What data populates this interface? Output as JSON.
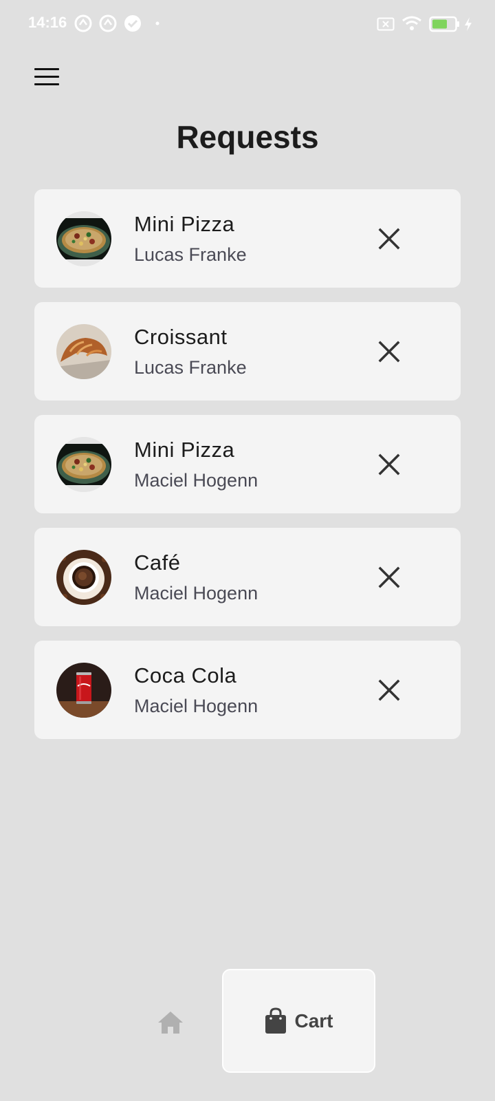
{
  "status_bar": {
    "time": "14:16",
    "battery_level": "56"
  },
  "header": {
    "menu_icon": "hamburger-menu-icon",
    "title": "Requests"
  },
  "requests": [
    {
      "item": "Mini Pizza",
      "user": "Lucas Franke",
      "image": "pizza"
    },
    {
      "item": "Croissant",
      "user": "Lucas Franke",
      "image": "croissant"
    },
    {
      "item": "Mini Pizza",
      "user": "Maciel Hogenn",
      "image": "pizza"
    },
    {
      "item": "Café",
      "user": "Maciel Hogenn",
      "image": "coffee"
    },
    {
      "item": "Coca Cola",
      "user": "Maciel Hogenn",
      "image": "soda-can"
    }
  ],
  "bottom_nav": {
    "home_icon": "home-icon",
    "cart_icon": "shopping-bag-icon",
    "cart_label": "Cart"
  },
  "colors": {
    "background": "#e0e0e0",
    "card": "#f4f4f4",
    "title": "#1c1c1c",
    "subtitle": "#4a4a55"
  }
}
